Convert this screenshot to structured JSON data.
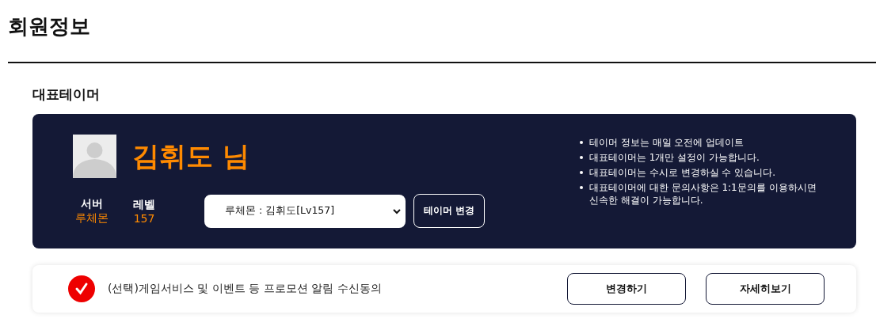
{
  "page_title": "회원정보",
  "section_title": "대표테이머",
  "profile": {
    "name": "김휘도 님",
    "stats": [
      {
        "label": "서버",
        "value": "루체몬"
      },
      {
        "label": "레벨",
        "value": "157"
      }
    ],
    "tamer_select": {
      "value": "루체몬 : 김휘도[Lv157]"
    },
    "change_button": "테이머 변경",
    "notes": [
      "테이머 정보는 매일 오전에 업데이트",
      "대표테이머는 1개만 설정이 가능합니다.",
      "대표테이머는 수시로 변경하실 수 있습니다.",
      "대표테이머에 대한 문의사항은 1:1문의를 이용하시면 신속한 해결이 가능합니다."
    ]
  },
  "consent": {
    "checked": true,
    "label": "(선택)게임서비스 및 이벤트 등 프로모션 알림 수신동의",
    "buttons": [
      "변경하기",
      "자세히보기"
    ]
  }
}
